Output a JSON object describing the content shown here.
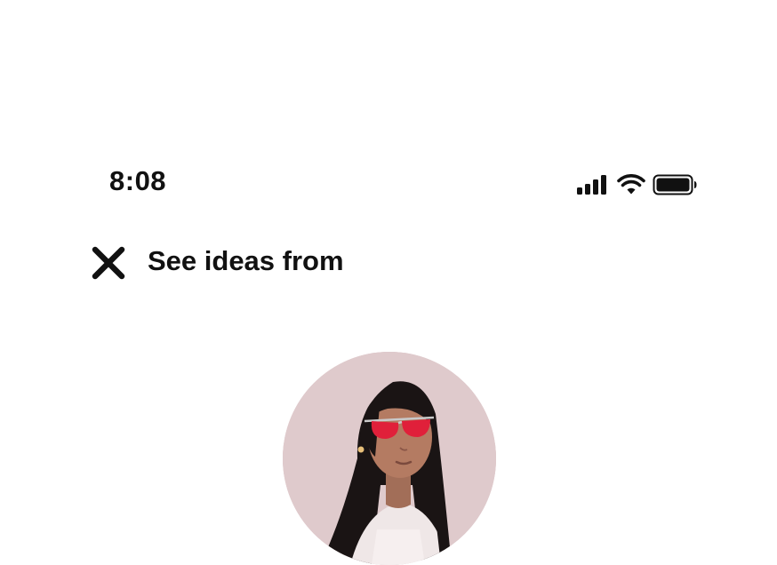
{
  "status_bar": {
    "time": "8:08",
    "icons": [
      "signal-icon",
      "wifi-icon",
      "battery-icon"
    ]
  },
  "header": {
    "close_icon": "close-icon",
    "title": "See ideas from"
  },
  "profile": {
    "avatar": "profile-avatar"
  },
  "colors": {
    "background": "#ffffff",
    "text": "#111111",
    "avatar_background": "#dcc6c8",
    "sunglasses": "#e0203a"
  }
}
